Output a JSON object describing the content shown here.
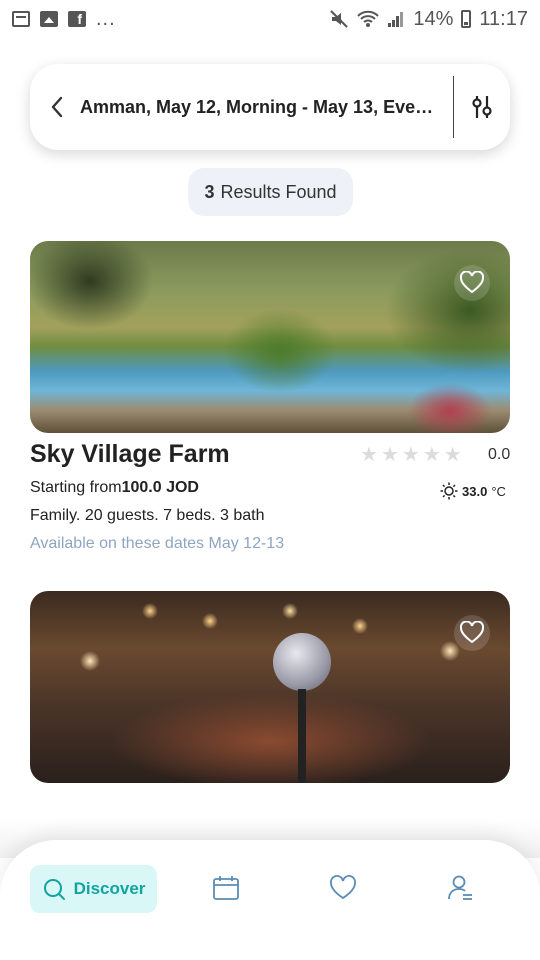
{
  "status_bar": {
    "battery": "14%",
    "time": "11:17",
    "more": "..."
  },
  "search": {
    "query": "Amman, May 12, Morning - May 13, Eveni..."
  },
  "results": {
    "count": "3",
    "label": "Results Found"
  },
  "cards": [
    {
      "title": "Sky Village Farm",
      "rating": "0.0",
      "stars": 0,
      "price_prefix": "Starting from",
      "price": "100.0 JOD",
      "temp_value": "33.0",
      "temp_unit": "°C",
      "details": "Family. 20 guests. 7 beds. 3 bath",
      "availability": "Available on these dates May 12-13"
    }
  ],
  "nav": {
    "discover": "Discover"
  },
  "colors": {
    "accent": "#12a4a0",
    "accent_bg": "#d9f7f6",
    "available_text": "#8ea5c1"
  }
}
